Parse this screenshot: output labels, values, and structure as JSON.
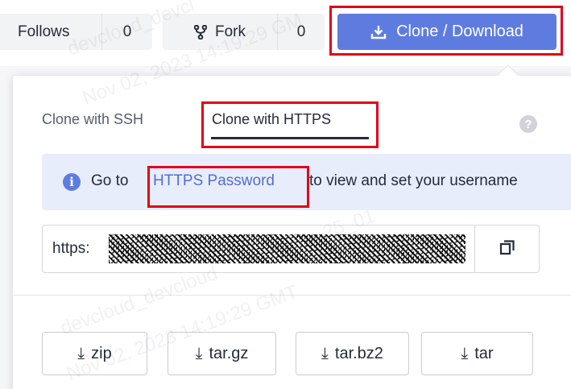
{
  "toolbar": {
    "follows_label": "Follows",
    "follows_count": "0",
    "fork_label": "Fork",
    "fork_count": "0",
    "clone_label": "Clone / Download"
  },
  "panel": {
    "tabs": [
      {
        "label": "Clone with SSH",
        "active": false
      },
      {
        "label": "Clone with HTTPS",
        "active": true
      }
    ],
    "help": "?",
    "info": {
      "icon": "i",
      "prefix": "Go to",
      "link": "HTTPS Password",
      "suffix": "to view and set your username"
    },
    "url": {
      "value": "https:"
    },
    "downloads": [
      "zip",
      "tar.gz",
      "tar.bz2",
      "tar"
    ],
    "download_arrow": "⤓"
  },
  "watermark": {
    "lines": [
      "devcloud_devcl",
      "Nov 02, 2023 14:19:29 GM",
      "25_01",
      "devcloud_devcloud",
      "Nov 02, 2023 14:19:29 GMT"
    ]
  },
  "colors": {
    "accent": "#5e7ce0",
    "link": "#526ecc",
    "highlight": "#e0001a",
    "info_bg": "#e8edfb"
  },
  "icons": {
    "fork": "fork-icon",
    "clone": "download-icon",
    "copy": "copy-icon",
    "help": "help-icon",
    "info": "info-icon"
  }
}
